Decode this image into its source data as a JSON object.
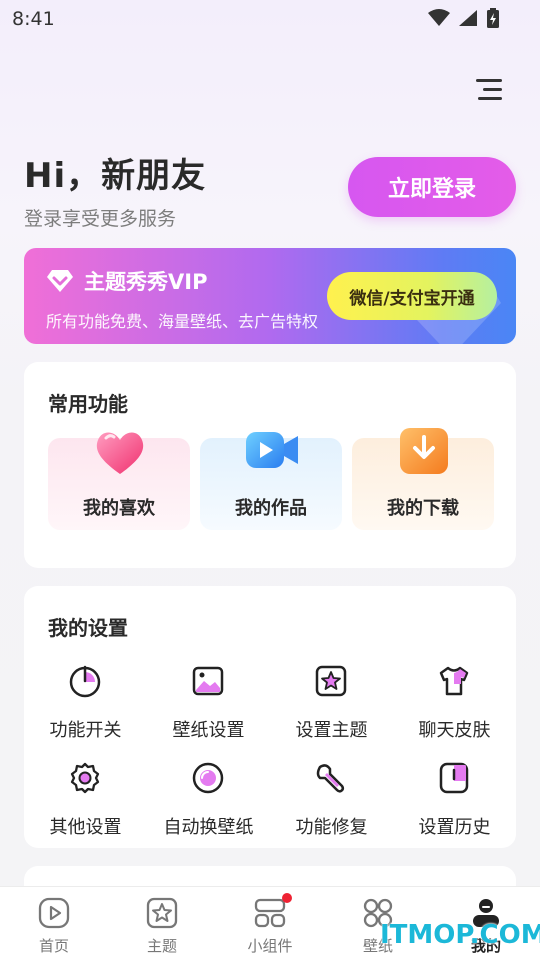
{
  "status_bar": {
    "time": "8:41"
  },
  "header": {
    "greeting": "Hi，新朋友",
    "subtitle": "登录享受更多服务",
    "login_label": "立即登录"
  },
  "vip": {
    "title": "主题秀秀VIP",
    "subtitle": "所有功能免费、海量壁纸、去广告特权",
    "button_label": "微信/支付宝开通"
  },
  "common_functions": {
    "title": "常用功能",
    "items": [
      {
        "label": "我的喜欢",
        "icon": "heart-icon"
      },
      {
        "label": "我的作品",
        "icon": "video-camera-icon"
      },
      {
        "label": "我的下载",
        "icon": "download-icon"
      }
    ]
  },
  "my_settings": {
    "title": "我的设置",
    "items": [
      {
        "label": "功能开关",
        "icon": "power-icon"
      },
      {
        "label": "壁纸设置",
        "icon": "image-icon"
      },
      {
        "label": "设置主题",
        "icon": "theme-star-icon"
      },
      {
        "label": "聊天皮肤",
        "icon": "tshirt-icon"
      },
      {
        "label": "其他设置",
        "icon": "gear-icon"
      },
      {
        "label": "自动换壁纸",
        "icon": "auto-wallpaper-icon"
      },
      {
        "label": "功能修复",
        "icon": "wrench-icon"
      },
      {
        "label": "设置历史",
        "icon": "history-icon"
      }
    ]
  },
  "tab_bar": {
    "tabs": [
      {
        "label": "首页",
        "icon": "play-icon"
      },
      {
        "label": "主题",
        "icon": "theme-icon"
      },
      {
        "label": "小组件",
        "icon": "widget-icon",
        "badge": true
      },
      {
        "label": "壁纸",
        "icon": "grid-icon"
      },
      {
        "label": "我的",
        "icon": "user-icon",
        "active": true
      }
    ]
  },
  "watermark": "ITMOP.COM",
  "colors": {
    "accent": "#d657f0",
    "vip_gradient_start": "#f06fd7",
    "vip_gradient_end": "#4a86f5",
    "vip_button": "#fff14e",
    "badge": "#ee2233"
  }
}
